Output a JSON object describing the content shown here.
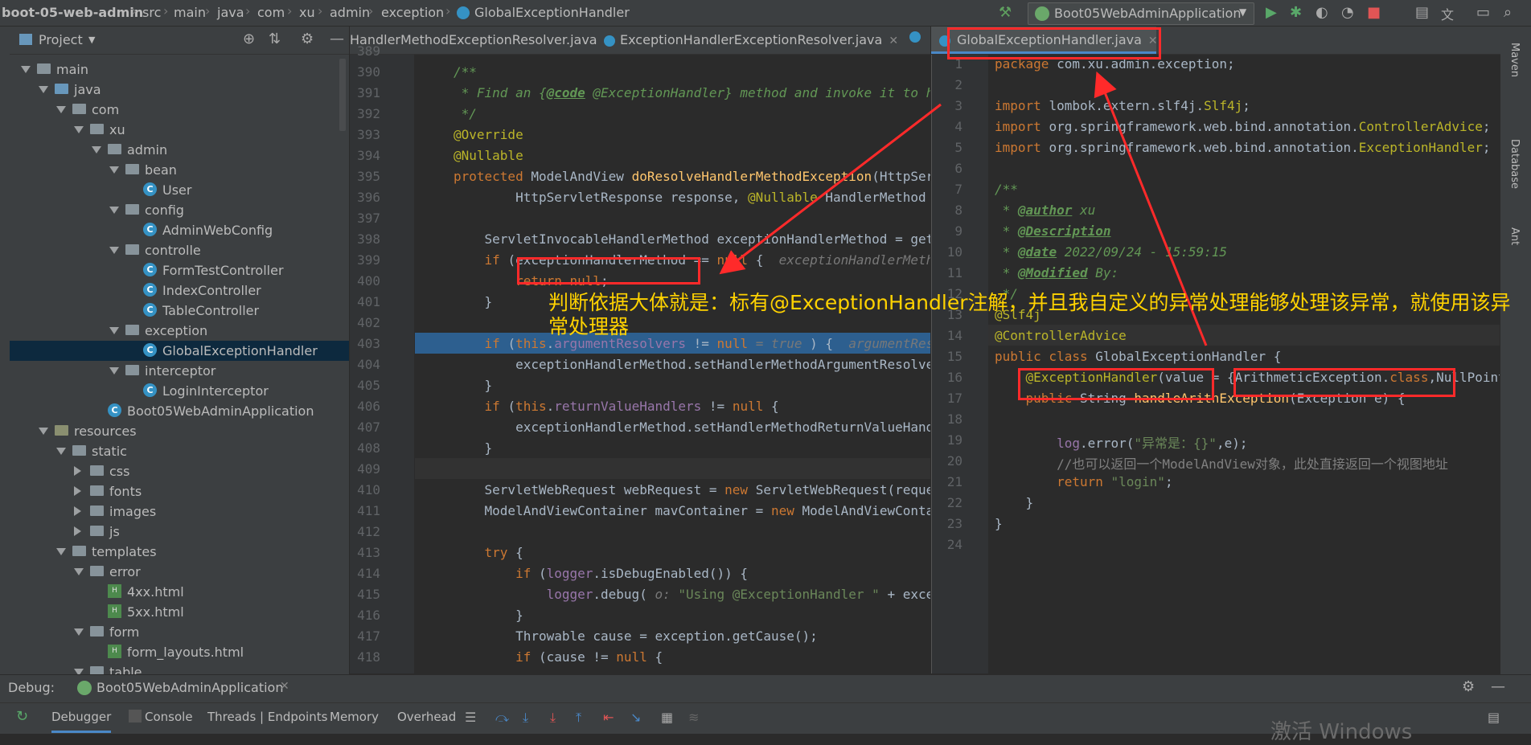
{
  "breadcrumb": [
    "boot-05-web-admin",
    "src",
    "main",
    "java",
    "com",
    "xu",
    "admin",
    "exception",
    "GlobalExceptionHandler"
  ],
  "run_config": {
    "label": "Boot05WebAdminApplication"
  },
  "project_panel": {
    "title": "Project",
    "tree": [
      {
        "label": "main",
        "kind": "folder",
        "open": true
      },
      {
        "label": "java",
        "kind": "folder-blue",
        "open": true
      },
      {
        "label": "com",
        "kind": "folder",
        "open": true
      },
      {
        "label": "xu",
        "kind": "folder",
        "open": true
      },
      {
        "label": "admin",
        "kind": "folder",
        "open": true
      },
      {
        "label": "bean",
        "kind": "folder",
        "open": true
      },
      {
        "label": "User",
        "kind": "class"
      },
      {
        "label": "config",
        "kind": "folder",
        "open": true
      },
      {
        "label": "AdminWebConfig",
        "kind": "class"
      },
      {
        "label": "controlle",
        "kind": "folder",
        "open": true
      },
      {
        "label": "FormTestController",
        "kind": "class"
      },
      {
        "label": "IndexController",
        "kind": "class"
      },
      {
        "label": "TableController",
        "kind": "class"
      },
      {
        "label": "exception",
        "kind": "folder",
        "open": true
      },
      {
        "label": "GlobalExceptionHandler",
        "kind": "class",
        "selected": true
      },
      {
        "label": "interceptor",
        "kind": "folder",
        "open": true
      },
      {
        "label": "LoginInterceptor",
        "kind": "class"
      },
      {
        "label": "Boot05WebAdminApplication",
        "kind": "class"
      },
      {
        "label": "resources",
        "kind": "folder-res",
        "open": true
      },
      {
        "label": "static",
        "kind": "folder",
        "open": true
      },
      {
        "label": "css",
        "kind": "folder",
        "open": false
      },
      {
        "label": "fonts",
        "kind": "folder",
        "open": false
      },
      {
        "label": "images",
        "kind": "folder",
        "open": false
      },
      {
        "label": "js",
        "kind": "folder",
        "open": false
      },
      {
        "label": "templates",
        "kind": "folder",
        "open": true
      },
      {
        "label": "error",
        "kind": "folder",
        "open": true
      },
      {
        "label": "4xx.html",
        "kind": "html"
      },
      {
        "label": "5xx.html",
        "kind": "html"
      },
      {
        "label": "form",
        "kind": "folder",
        "open": true
      },
      {
        "label": "form_layouts.html",
        "kind": "html"
      },
      {
        "label": "table",
        "kind": "folder",
        "open": true
      }
    ]
  },
  "left_tabs": [
    "HandlerMethodExceptionResolver.java",
    "ExceptionHandlerExceptionResolver.java"
  ],
  "right_tabs": [
    "GlobalExceptionHandler.java"
  ],
  "left_editor": {
    "lines": [
      {
        "n": "389",
        "segs": []
      },
      {
        "n": "390",
        "segs": [
          [
            "cm",
            "/**"
          ]
        ]
      },
      {
        "n": "391",
        "segs": [
          [
            "cm",
            " * Find an {"
          ],
          [
            "cmtag",
            "@code"
          ],
          [
            "cm",
            " @ExceptionHandler} method and invoke it to handle the raised exception."
          ]
        ]
      },
      {
        "n": "392",
        "segs": [
          [
            "cm",
            " */"
          ]
        ]
      },
      {
        "n": "393",
        "segs": [
          [
            "an",
            "@Override"
          ]
        ]
      },
      {
        "n": "394",
        "segs": [
          [
            "an",
            "@Nullable"
          ]
        ]
      },
      {
        "n": "395",
        "segs": [
          [
            "kw",
            "protected "
          ],
          [
            "",
            "ModelAndView "
          ],
          [
            "fn",
            "doResolveHandlerMethodException"
          ],
          [
            "",
            "(HttpServletRequest request,"
          ]
        ]
      },
      {
        "n": "396",
        "segs": [
          [
            "",
            "        HttpServletResponse response, "
          ],
          [
            "an",
            "@Nullable"
          ],
          [
            "",
            " HandlerMethod handlerMethod, Exception exception) {"
          ]
        ]
      },
      {
        "n": "397",
        "segs": []
      },
      {
        "n": "398",
        "segs": [
          [
            "",
            "    ServletInvocableHandlerMethod exceptionHandlerMethod = getExceptionHandlerMethod(handlerMethod, exception);"
          ]
        ]
      },
      {
        "n": "399",
        "segs": [
          [
            "",
            "    "
          ],
          [
            "kw",
            "if "
          ],
          [
            "",
            "(exceptionHandlerMethod == "
          ],
          [
            "kw",
            "null"
          ],
          [
            "",
            " {  "
          ],
          [
            "hint",
            "exceptionHandlerMethod: "
          ]
        ]
      },
      {
        "n": "400",
        "segs": [
          [
            "",
            "        "
          ],
          [
            "kw",
            "return null"
          ],
          [
            "",
            ";"
          ]
        ]
      },
      {
        "n": "401",
        "segs": [
          [
            "",
            "    }"
          ]
        ]
      },
      {
        "n": "402",
        "segs": []
      },
      {
        "n": "403",
        "segs": [
          [
            "",
            "    "
          ],
          [
            "kw",
            "if "
          ],
          [
            "",
            "("
          ],
          [
            "kw",
            "this"
          ],
          [
            "",
            "."
          ],
          [
            "fld",
            "argumentResolvers"
          ],
          [
            "",
            " != "
          ],
          [
            "kw",
            "null"
          ],
          [
            "hint",
            " = true "
          ],
          [
            "",
            ") {  "
          ],
          [
            "hint",
            "argumentResolvers: "
          ]
        ]
      },
      {
        "n": "404",
        "segs": [
          [
            "",
            "        exceptionHandlerMethod.setHandlerMethodArgumentResolvers("
          ],
          [
            "kw",
            "this"
          ],
          [
            "",
            "."
          ],
          [
            "fld",
            "argumentResolvers"
          ],
          [
            ");"
          ]
        ]
      },
      {
        "n": "405",
        "segs": [
          [
            "",
            "    }"
          ]
        ]
      },
      {
        "n": "406",
        "segs": [
          [
            "",
            "    "
          ],
          [
            "kw",
            "if "
          ],
          [
            "",
            "("
          ],
          [
            "kw",
            "this"
          ],
          [
            "",
            "."
          ],
          [
            "fld",
            "returnValueHandlers"
          ],
          [
            "",
            " != "
          ],
          [
            "kw",
            "null"
          ],
          [
            "",
            " {"
          ]
        ]
      },
      {
        "n": "407",
        "segs": [
          [
            "",
            "        exceptionHandlerMethod.setHandlerMethodReturnValueHandlers("
          ],
          [
            "kw",
            "this"
          ],
          [
            "",
            "."
          ],
          [
            "fld",
            "returnValueHandlers"
          ],
          [
            ");"
          ]
        ]
      },
      {
        "n": "408",
        "segs": [
          [
            "",
            "    }"
          ]
        ]
      },
      {
        "n": "409",
        "segs": []
      },
      {
        "n": "410",
        "segs": [
          [
            "",
            "    ServletWebRequest webRequest = "
          ],
          [
            "kw",
            "new "
          ],
          [
            "",
            "ServletWebRequest(request, response);"
          ]
        ]
      },
      {
        "n": "411",
        "segs": [
          [
            "",
            "    ModelAndViewContainer mavContainer = "
          ],
          [
            "kw",
            "new "
          ],
          [
            "",
            "ModelAndViewContainer();"
          ]
        ]
      },
      {
        "n": "412",
        "segs": []
      },
      {
        "n": "413",
        "segs": [
          [
            "",
            "    "
          ],
          [
            "kw",
            "try "
          ],
          [
            "",
            "{"
          ]
        ]
      },
      {
        "n": "414",
        "segs": [
          [
            "",
            "        "
          ],
          [
            "kw",
            "if "
          ],
          [
            "",
            "("
          ],
          [
            "fld",
            "logger"
          ],
          [
            "",
            ".isDebugEnabled()) {"
          ]
        ]
      },
      {
        "n": "415",
        "segs": [
          [
            "",
            "            "
          ],
          [
            "fld",
            "logger"
          ],
          [
            "",
            ".debug( "
          ],
          [
            "hint",
            "o: "
          ],
          [
            "st",
            "\"Using @ExceptionHandler \""
          ],
          [
            "",
            " + exceptionHandlerMethod);"
          ]
        ]
      },
      {
        "n": "416",
        "segs": [
          [
            "",
            "        }"
          ]
        ]
      },
      {
        "n": "417",
        "segs": [
          [
            "",
            "        Throwable cause = exception.getCause();"
          ]
        ]
      },
      {
        "n": "418",
        "segs": [
          [
            "",
            "        "
          ],
          [
            "kw",
            "if "
          ],
          [
            "",
            "(cause != "
          ],
          [
            "kw",
            "null"
          ],
          [
            "",
            " {"
          ]
        ]
      }
    ]
  },
  "right_editor": {
    "lines": [
      {
        "n": "1",
        "segs": [
          [
            "kw",
            "package "
          ],
          [
            "",
            "com.xu.admin.exception;"
          ]
        ]
      },
      {
        "n": "2",
        "segs": []
      },
      {
        "n": "3",
        "segs": [
          [
            "kw",
            "import "
          ],
          [
            "",
            "lombok.extern.slf4j."
          ],
          [
            "an",
            "Slf4j"
          ],
          [
            "",
            ";"
          ]
        ]
      },
      {
        "n": "4",
        "segs": [
          [
            "kw",
            "import "
          ],
          [
            "",
            "org.springframework.web.bind.annotation."
          ],
          [
            "an",
            "ControllerAdvice"
          ],
          [
            "",
            ";"
          ]
        ]
      },
      {
        "n": "5",
        "segs": [
          [
            "kw",
            "import "
          ],
          [
            "",
            "org.springframework.web.bind.annotation."
          ],
          [
            "an",
            "ExceptionHandler"
          ],
          [
            "",
            ";"
          ]
        ]
      },
      {
        "n": "6",
        "segs": []
      },
      {
        "n": "7",
        "segs": [
          [
            "cm",
            "/**"
          ]
        ]
      },
      {
        "n": "8",
        "segs": [
          [
            "cm",
            " * "
          ],
          [
            "cmtag",
            "@author"
          ],
          [
            "cm",
            " xu"
          ]
        ]
      },
      {
        "n": "9",
        "segs": [
          [
            "cm",
            " * "
          ],
          [
            "cmtag",
            "@Description"
          ]
        ]
      },
      {
        "n": "10",
        "segs": [
          [
            "cm",
            " * "
          ],
          [
            "cmtag",
            "@date"
          ],
          [
            "cm",
            " 2022/09/24 - 15:59:15"
          ]
        ]
      },
      {
        "n": "11",
        "segs": [
          [
            "cm",
            " * "
          ],
          [
            "cmtag",
            "@Modified"
          ],
          [
            "cm",
            " By:"
          ]
        ]
      },
      {
        "n": "12",
        "segs": [
          [
            "cm",
            " */"
          ]
        ]
      },
      {
        "n": "13",
        "segs": [
          [
            "an",
            "@Slf4j"
          ]
        ]
      },
      {
        "n": "14",
        "segs": [
          [
            "an",
            "@ControllerAdvice"
          ]
        ]
      },
      {
        "n": "15",
        "segs": [
          [
            "kw",
            "public class "
          ],
          [
            "",
            "GlobalExceptionHandler {"
          ]
        ]
      },
      {
        "n": "16",
        "segs": [
          [
            "",
            "    "
          ],
          [
            "an",
            "@ExceptionHandler"
          ],
          [
            "",
            "(value = {ArithmeticException."
          ],
          [
            "kw",
            "class"
          ],
          [
            "",
            ",NullPointerException."
          ],
          [
            "kw",
            "class"
          ],
          [
            "",
            "})"
          ]
        ]
      },
      {
        "n": "17",
        "segs": [
          [
            "",
            "    "
          ],
          [
            "kw",
            "public "
          ],
          [
            "",
            "String "
          ],
          [
            "fn",
            "handleArithException"
          ],
          [
            "",
            "(Exception e) {"
          ]
        ]
      },
      {
        "n": "18",
        "segs": []
      },
      {
        "n": "19",
        "segs": [
          [
            "",
            "        "
          ],
          [
            "fld",
            "log"
          ],
          [
            "",
            ".error("
          ],
          [
            "st",
            "\"异常是：{}\""
          ],
          [
            "",
            ",e);"
          ]
        ]
      },
      {
        "n": "20",
        "segs": [
          [
            "",
            "        "
          ],
          [
            "lc",
            "//也可以返回一个ModelAndView对象，此处直接返回一个视图地址"
          ]
        ]
      },
      {
        "n": "21",
        "segs": [
          [
            "",
            "        "
          ],
          [
            "kw",
            "return "
          ],
          [
            "st",
            "\"login\""
          ],
          [
            "",
            ";"
          ]
        ]
      },
      {
        "n": "22",
        "segs": [
          [
            "",
            "    }"
          ]
        ]
      },
      {
        "n": "23",
        "segs": [
          [
            "",
            "}"
          ]
        ]
      },
      {
        "n": "24",
        "segs": []
      }
    ]
  },
  "annotation_text": "判断依据大体就是：标有@ExceptionHandler注解，并且我自定义的异常处理能够处理该异常，就使用该异常处理器",
  "debug": {
    "label": "Debug:",
    "session": "Boot05WebAdminApplication",
    "tabs": [
      "Debugger",
      "Console",
      "Threads | Endpoints",
      "Memory",
      "Overhead"
    ]
  },
  "right_strip": [
    "Maven",
    "Database",
    "Ant"
  ],
  "watermark": "激活 Windows",
  "colors": {
    "annotation": "#ff2a2a",
    "annotation_text": "#ffd200",
    "selection": "#0d293e",
    "breakpoint_line": "#2d5f8f"
  }
}
